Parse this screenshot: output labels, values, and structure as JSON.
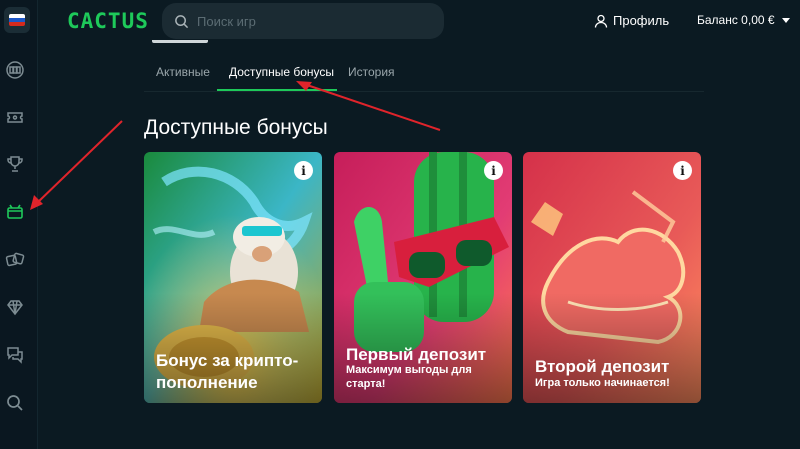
{
  "sidebar": {
    "flag": "russia-flag",
    "flag_colors": [
      "#ffffff",
      "#1c57c7",
      "#d52b1e"
    ],
    "items": [
      {
        "icon": "slots-icon"
      },
      {
        "icon": "ticket-icon"
      },
      {
        "icon": "trophy-icon"
      },
      {
        "icon": "gift-icon",
        "active": true
      },
      {
        "icon": "dice-icon"
      },
      {
        "icon": "diamond-icon"
      },
      {
        "icon": "chat-icon"
      },
      {
        "icon": "search-icon"
      }
    ]
  },
  "header": {
    "logo": "CACTUS",
    "search_placeholder": "Поиск игр",
    "profile_label": "Профиль",
    "balance_label": "Баланс 0,00 €"
  },
  "tabs": [
    {
      "label": "Активные",
      "active": false
    },
    {
      "label": "Доступные бонусы",
      "active": true
    },
    {
      "label": "История",
      "active": false
    }
  ],
  "section_title": "Доступные бонусы",
  "cards": [
    {
      "title_line1": "Бонус за крипто-",
      "title_line2": "пополнение",
      "subtitle": "",
      "info": "i"
    },
    {
      "title_line1": "Первый депозит",
      "title_line2": "",
      "subtitle_line1": "Максимум выгоды для",
      "subtitle_line2": "старта!",
      "info": "i"
    },
    {
      "title_line1": "Второй депозит",
      "title_line2": "",
      "subtitle_line1": "Игра только начинается!",
      "subtitle_line2": "",
      "info": "i"
    }
  ],
  "colors": {
    "accent": "#1ec95a",
    "background": "#0b1a22",
    "annotation_arrow": "#e0242b"
  }
}
